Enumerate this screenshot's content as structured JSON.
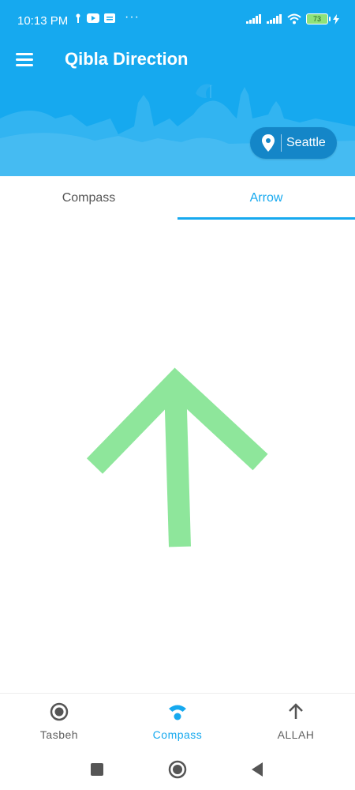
{
  "status_bar": {
    "time": "10:13 PM",
    "left_icons": [
      "wifi-tether-icon",
      "youtube-icon",
      "notification-icon"
    ],
    "dots": "···",
    "battery_level": "73",
    "right_icons": [
      "signal-icon",
      "signal-icon",
      "wifi-icon",
      "battery-icon",
      "charging-icon"
    ]
  },
  "header": {
    "title": "Qibla Direction",
    "menu_icon": "hamburger-menu-icon",
    "location": {
      "icon": "location-pin-icon",
      "label": "Seattle"
    },
    "colors": {
      "background": "#16a9ef",
      "chip": "#1486c8"
    }
  },
  "tabs": {
    "items": [
      {
        "label": "Compass",
        "active": false
      },
      {
        "label": "Arrow",
        "active": true
      }
    ]
  },
  "arrow": {
    "icon": "qibla-arrow-icon",
    "color": "#8ee69b"
  },
  "bottom_nav": {
    "items": [
      {
        "label": "Tasbeh",
        "icon": "radio-circle-icon",
        "active": false
      },
      {
        "label": "Compass",
        "icon": "wifi-compass-icon",
        "active": true
      },
      {
        "label": "ALLAH",
        "icon": "arrow-up-icon",
        "active": false
      }
    ],
    "active_color": "#16a9ef"
  },
  "system_nav": {
    "buttons": [
      "recents-square-icon",
      "home-circle-icon",
      "back-triangle-icon"
    ]
  }
}
